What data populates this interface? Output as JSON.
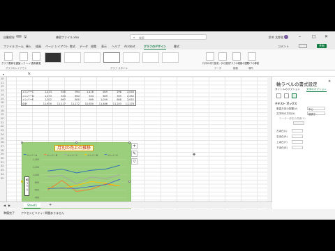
{
  "titlebar": {
    "autosave_label": "自動保存",
    "filename": "練習ファイル.xlsx",
    "search_placeholder": "検索",
    "user_name": "鈴木 太郎花"
  },
  "menu": [
    "ファイル",
    "ホーム",
    "挿入",
    "描画",
    "ページ レイアウト",
    "数式",
    "データ",
    "校閲",
    "表示",
    "ヘルプ",
    "Acrobat",
    "グラフのデザイン",
    "書式"
  ],
  "menu_active_index": 11,
  "ribbon": {
    "add_element_label": "グラフ要素を追加",
    "quick_layout_label": "クイック レイアウト",
    "change_colors_label": "色の変更",
    "layout_group": "グラフのレイアウト",
    "styles_group": "グラフ スタイル",
    "switch_row_col_label": "行/列の切り替え",
    "select_data_label": "データの選択",
    "change_type_label": "グラフの種類の変更",
    "move_chart_label": "グラフの移動",
    "data_group": "データ",
    "type_group": "種類",
    "location_group": "場所",
    "comment_label": "コメント",
    "share_label": "共有"
  },
  "rows": [
    "10",
    "11",
    "12",
    "13",
    "14",
    "15",
    "16",
    "17",
    "18",
    "19",
    "20",
    "21",
    "22",
    "23",
    "24",
    "25",
    "26",
    "27",
    "28",
    "29",
    "30",
    "31",
    "32",
    "33",
    "34",
    "35"
  ],
  "table": [
    {
      "label": "メンバーC",
      "values": [
        "1,413",
        "540",
        "994",
        "1,416",
        "609",
        "298",
        "2,040"
      ]
    },
    {
      "label": "メンバーD",
      "values": [
        "1,273",
        "534",
        "894",
        "534",
        "609",
        "305",
        "2,352"
      ]
    },
    {
      "label": "メンバーE",
      "values": [
        "1,022",
        "897",
        "800",
        "999",
        "1,059",
        "608",
        "2,052"
      ]
    },
    {
      "label": "合計",
      "values": [
        "11,670",
        "11,117",
        "11,172",
        "10,630",
        "11,488",
        "11,203",
        "11,278"
      ]
    }
  ],
  "chart": {
    "title": "月別の売上の推移",
    "legend": [
      "メンバーA",
      "メンバーB",
      "メンバーC",
      "メンバーD",
      "メンバーE"
    ],
    "y_tick_labels": [
      "1,400",
      "1,200",
      "1,000",
      "800",
      "600",
      "400",
      "200",
      "0"
    ],
    "x_tick_labels": [
      "1月",
      "2月",
      "3月",
      "4月",
      "5月",
      "6月"
    ],
    "axis_title_box": "軸ラベル",
    "side_buttons": [
      "+",
      "✎",
      "▽"
    ]
  },
  "chart_data": {
    "type": "line",
    "categories": [
      "1月",
      "2月",
      "3月",
      "4月",
      "5月",
      "6月"
    ],
    "ylim": [
      0,
      1400
    ],
    "series": [
      {
        "name": "メンバーA",
        "color": "#2e75b6",
        "values": [
          1100,
          1150,
          1050,
          1120,
          1150,
          1250
        ]
      },
      {
        "name": "メンバーB",
        "color": "#ed7d31",
        "values": [
          600,
          850,
          560,
          620,
          760,
          700
        ]
      },
      {
        "name": "メンバーC",
        "color": "#a5a5a5",
        "values": [
          950,
          980,
          760,
          940,
          900,
          1000
        ]
      },
      {
        "name": "メンバーD",
        "color": "#ffc000",
        "values": [
          660,
          640,
          720,
          820,
          780,
          700
        ]
      },
      {
        "name": "メンバーE",
        "color": "#4472c4",
        "values": [
          640,
          650,
          640,
          690,
          740,
          880
        ]
      }
    ],
    "grid": true,
    "legend_position": "top"
  },
  "pane": {
    "title": "軸ラベルの書式設定",
    "tab_title_options": "タイトルのオプション",
    "tab_text_options": "文字のオプション",
    "section_textbox": "テキスト ボックス",
    "vertical_align_label": "垂直方向の配置(V)",
    "vertical_align_value": "中心",
    "text_direction_label": "文字列の方向(X)",
    "text_direction_value": "縦書き",
    "custom_angle_label": "ユーザー設定の角度(U)",
    "left_margin_label": "左余白(L)",
    "right_margin_label": "右余白(R)",
    "top_margin_label": "上余白(T)",
    "bottom_margin_label": "下余白(B)"
  },
  "sheet_tab": "Sheet1",
  "status": {
    "left": "準備完了",
    "accessibility": "アクセシビリティ: 問題ありません"
  }
}
